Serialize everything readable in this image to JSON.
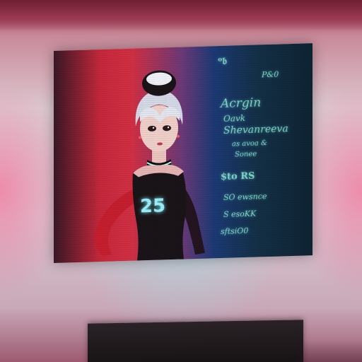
{
  "screen": {
    "top_glyph": "ᵒ𝔟",
    "number": "P&0",
    "lines": [
      "Acrgin",
      "Oavk",
      "Shevanreeva",
      "as avoa &",
      "Sonee",
      "$to RS",
      "SO ewsnce",
      "S esoKK",
      "sftsiO0"
    ],
    "jersey_number": "25"
  },
  "colors": {
    "screen_red": "#d43044",
    "screen_blue": "#1c3a76",
    "text_teal": "#7fd6c8",
    "outfit_black": "#1a1418"
  }
}
